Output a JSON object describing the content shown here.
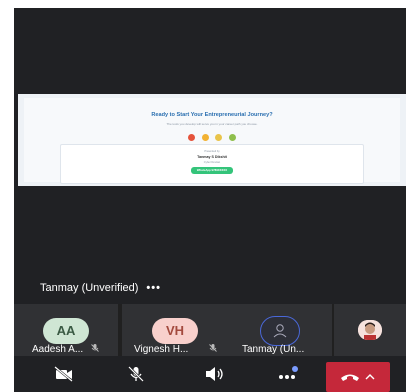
{
  "shared_screen": {
    "title": "Ready to Start Your Entrepreneurial Journey?",
    "subtitle": "The tools you develop will serve you in your career path you choose.",
    "card_line1": "Presented by",
    "card_name": "Tanmay S Dikshit",
    "card_line3": "Cyber Devtian",
    "card_button": "WhatsApp 9789XXXXX"
  },
  "presenter": {
    "label": "Tanmay (Unverified)",
    "more": "•••"
  },
  "participants": [
    {
      "initials": "AA",
      "name": "Aadesh A...",
      "muted": true
    },
    {
      "initials": "VH",
      "name": "Vignesh H...",
      "muted": true
    },
    {
      "initials": "",
      "name": "Tanmay (Un...",
      "muted": false
    },
    {
      "initials": "",
      "name": "",
      "muted": false
    }
  ],
  "controls": {
    "camera": "camera-off-icon",
    "mic": "mic-off-icon",
    "speaker": "speaker-icon",
    "more": "more-icon",
    "end_call": "end-call-icon"
  },
  "colors": {
    "end_call": "#c5283a",
    "tile_bg": "#303134",
    "stage_bg": "#202124"
  }
}
